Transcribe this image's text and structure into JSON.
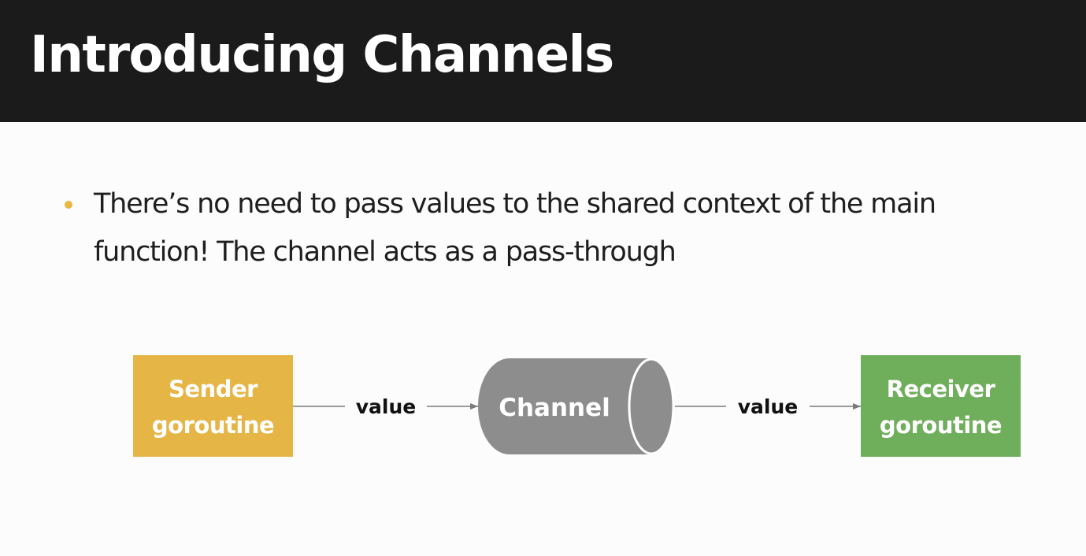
{
  "slide": {
    "title": "Introducing Channels",
    "bullets": [
      "There’s no need to pass values to the shared context of the main function! The channel acts as a pass-through"
    ]
  },
  "diagram": {
    "sender": {
      "line1": "Sender",
      "line2": "goroutine",
      "color": "#e5b646"
    },
    "channel": {
      "label": "Channel",
      "color": "#8d8d8d"
    },
    "receiver": {
      "line1": "Receiver",
      "line2": "goroutine",
      "color": "#6fae5b"
    },
    "edges": [
      {
        "label": "value"
      },
      {
        "label": "value"
      }
    ],
    "bullet_color": "#e9b740"
  }
}
